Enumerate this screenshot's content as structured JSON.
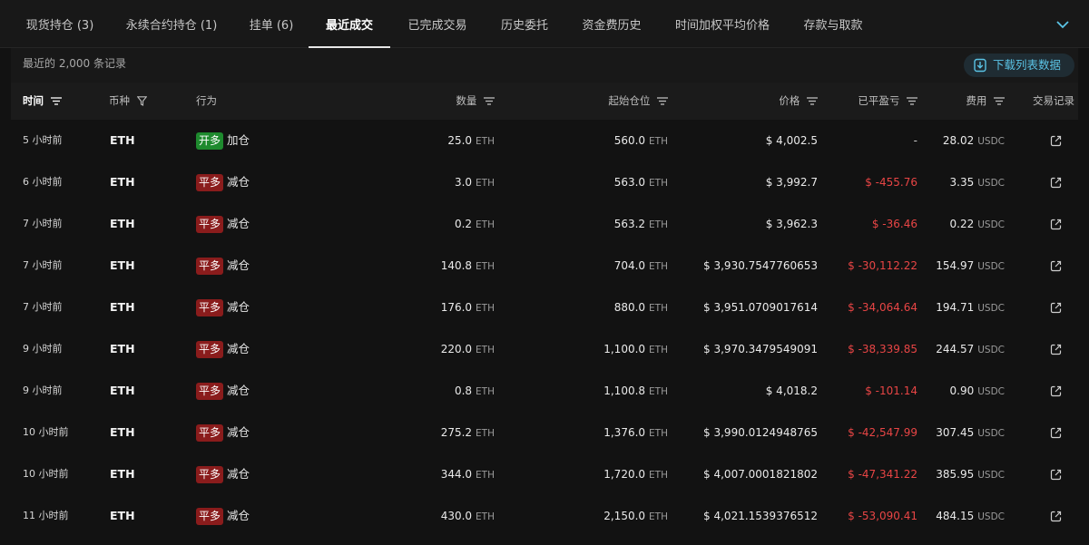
{
  "tabs": [
    {
      "label": "现货持仓 (3)",
      "active": false
    },
    {
      "label": "永续合约持仓 (1)",
      "active": false
    },
    {
      "label": "挂单 (6)",
      "active": false
    },
    {
      "label": "最近成交",
      "active": true
    },
    {
      "label": "已完成交易",
      "active": false
    },
    {
      "label": "历史委托",
      "active": false
    },
    {
      "label": "资金费历史",
      "active": false
    },
    {
      "label": "时间加权平均价格",
      "active": false
    },
    {
      "label": "存款与取款",
      "active": false
    }
  ],
  "subheader": {
    "record_count": "最近的 2,000 条记录",
    "download_label": "下载列表数据"
  },
  "columns": {
    "time": "时间",
    "coin": "币种",
    "action": "行为",
    "qty": "数量",
    "start_pos": "起始仓位",
    "price": "价格",
    "pnl": "已平盈亏",
    "fee": "费用",
    "record": "交易记录"
  },
  "rows": [
    {
      "time": "5 小时前",
      "coin": "ETH",
      "badge": "开多",
      "badge_type": "open",
      "action": "加仓",
      "qty": "25.0",
      "qty_unit": "ETH",
      "start_pos": "560.0",
      "start_unit": "ETH",
      "price": "$ 4,002.5",
      "pnl": "-",
      "fee": "28.02",
      "fee_unit": "USDC"
    },
    {
      "time": "6 小时前",
      "coin": "ETH",
      "badge": "平多",
      "badge_type": "close",
      "action": "减仓",
      "qty": "3.0",
      "qty_unit": "ETH",
      "start_pos": "563.0",
      "start_unit": "ETH",
      "price": "$ 3,992.7",
      "pnl": "$ -455.76",
      "fee": "3.35",
      "fee_unit": "USDC"
    },
    {
      "time": "7 小时前",
      "coin": "ETH",
      "badge": "平多",
      "badge_type": "close",
      "action": "减仓",
      "qty": "0.2",
      "qty_unit": "ETH",
      "start_pos": "563.2",
      "start_unit": "ETH",
      "price": "$ 3,962.3",
      "pnl": "$ -36.46",
      "fee": "0.22",
      "fee_unit": "USDC"
    },
    {
      "time": "7 小时前",
      "coin": "ETH",
      "badge": "平多",
      "badge_type": "close",
      "action": "减仓",
      "qty": "140.8",
      "qty_unit": "ETH",
      "start_pos": "704.0",
      "start_unit": "ETH",
      "price": "$ 3,930.7547760653",
      "pnl": "$ -30,112.22",
      "fee": "154.97",
      "fee_unit": "USDC"
    },
    {
      "time": "7 小时前",
      "coin": "ETH",
      "badge": "平多",
      "badge_type": "close",
      "action": "减仓",
      "qty": "176.0",
      "qty_unit": "ETH",
      "start_pos": "880.0",
      "start_unit": "ETH",
      "price": "$ 3,951.0709017614",
      "pnl": "$ -34,064.64",
      "fee": "194.71",
      "fee_unit": "USDC"
    },
    {
      "time": "9 小时前",
      "coin": "ETH",
      "badge": "平多",
      "badge_type": "close",
      "action": "减仓",
      "qty": "220.0",
      "qty_unit": "ETH",
      "start_pos": "1,100.0",
      "start_unit": "ETH",
      "price": "$ 3,970.3479549091",
      "pnl": "$ -38,339.85",
      "fee": "244.57",
      "fee_unit": "USDC"
    },
    {
      "time": "9 小时前",
      "coin": "ETH",
      "badge": "平多",
      "badge_type": "close",
      "action": "减仓",
      "qty": "0.8",
      "qty_unit": "ETH",
      "start_pos": "1,100.8",
      "start_unit": "ETH",
      "price": "$ 4,018.2",
      "pnl": "$ -101.14",
      "fee": "0.90",
      "fee_unit": "USDC"
    },
    {
      "time": "10 小时前",
      "coin": "ETH",
      "badge": "平多",
      "badge_type": "close",
      "action": "减仓",
      "qty": "275.2",
      "qty_unit": "ETH",
      "start_pos": "1,376.0",
      "start_unit": "ETH",
      "price": "$ 3,990.0124948765",
      "pnl": "$ -42,547.99",
      "fee": "307.45",
      "fee_unit": "USDC"
    },
    {
      "time": "10 小时前",
      "coin": "ETH",
      "badge": "平多",
      "badge_type": "close",
      "action": "减仓",
      "qty": "344.0",
      "qty_unit": "ETH",
      "start_pos": "1,720.0",
      "start_unit": "ETH",
      "price": "$ 4,007.0001821802",
      "pnl": "$ -47,341.22",
      "fee": "385.95",
      "fee_unit": "USDC"
    },
    {
      "time": "11 小时前",
      "coin": "ETH",
      "badge": "平多",
      "badge_type": "close",
      "action": "减仓",
      "qty": "430.0",
      "qty_unit": "ETH",
      "start_pos": "2,150.0",
      "start_unit": "ETH",
      "price": "$ 4,021.1539376512",
      "pnl": "$ -53,090.41",
      "fee": "484.15",
      "fee_unit": "USDC"
    }
  ],
  "colors": {
    "background": "#121212",
    "accent": "#5bc4e6",
    "loss": "#e84545",
    "open_badge": "#1e8a2e",
    "close_badge": "#8a1c1c"
  },
  "icons": {
    "download": "download-icon",
    "sort": "sort-icon",
    "filter": "filter-icon",
    "external_link": "external-link-icon",
    "chevron": "chevron-down-icon"
  }
}
